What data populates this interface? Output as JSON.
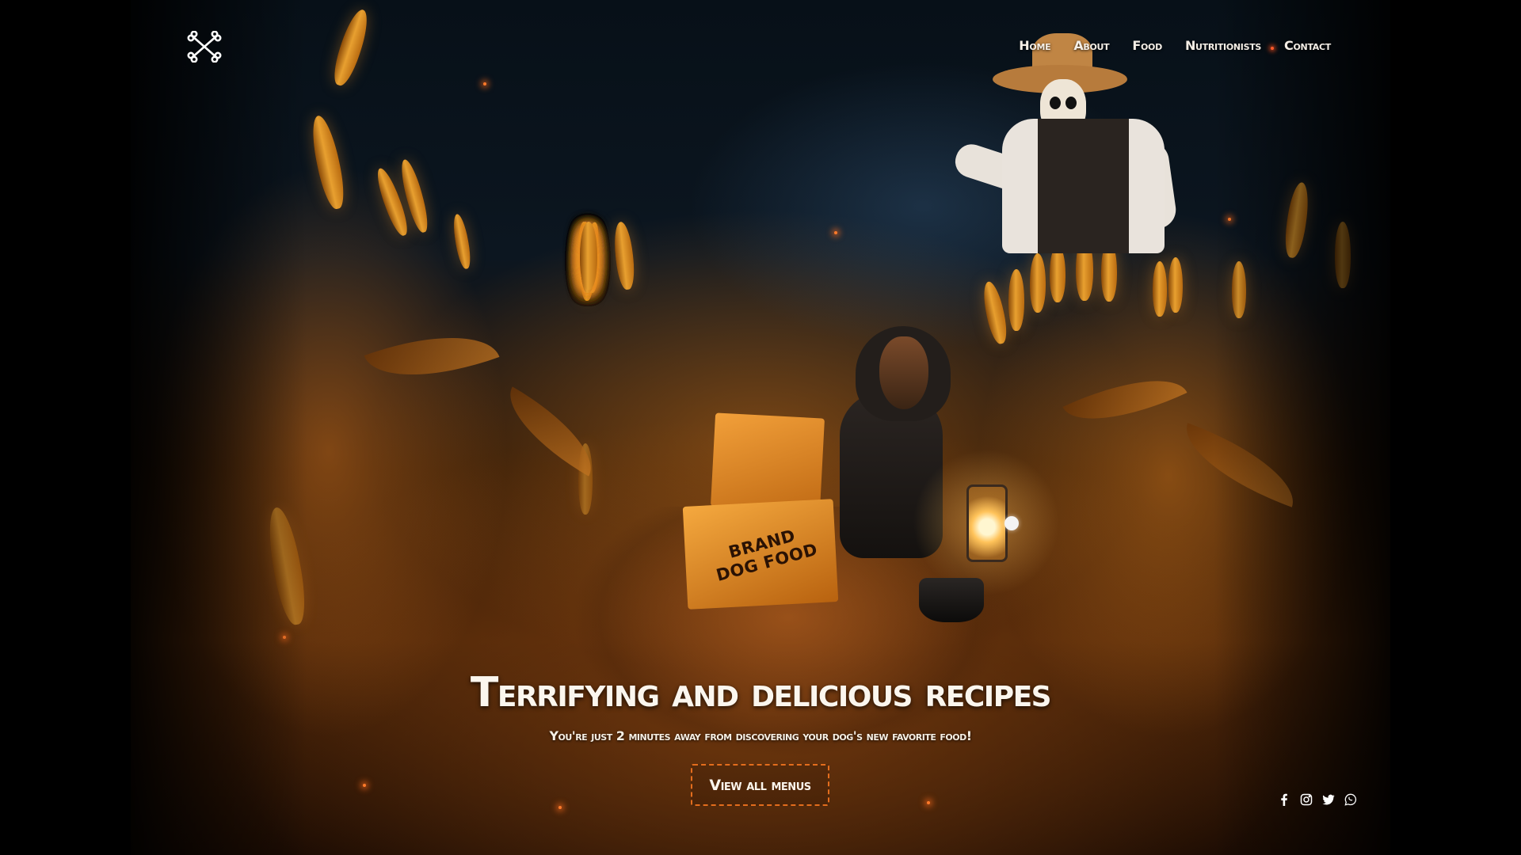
{
  "brand": {
    "logo_icon": "crossed-bones-icon"
  },
  "nav": {
    "items": [
      {
        "label": "Home"
      },
      {
        "label": "About"
      },
      {
        "label": "Food"
      },
      {
        "label": "Nutritionists"
      },
      {
        "label": "Contact"
      }
    ]
  },
  "scene": {
    "box_label_line1": "BRAND",
    "box_label_line2": "DOG FOOD"
  },
  "hero": {
    "title": "Terrifying and delicious recipes",
    "subtitle": "You're just 2 minutes away from discovering your dog's new favorite food!",
    "cta_label": "View all menus"
  },
  "slider": {
    "active_index": 0,
    "total": 1
  },
  "social": {
    "icons": [
      "facebook-icon",
      "instagram-icon",
      "twitter-icon",
      "whatsapp-icon"
    ]
  },
  "colors": {
    "accent": "#e36d1d",
    "text": "#f4eee6",
    "background": "#000000"
  }
}
